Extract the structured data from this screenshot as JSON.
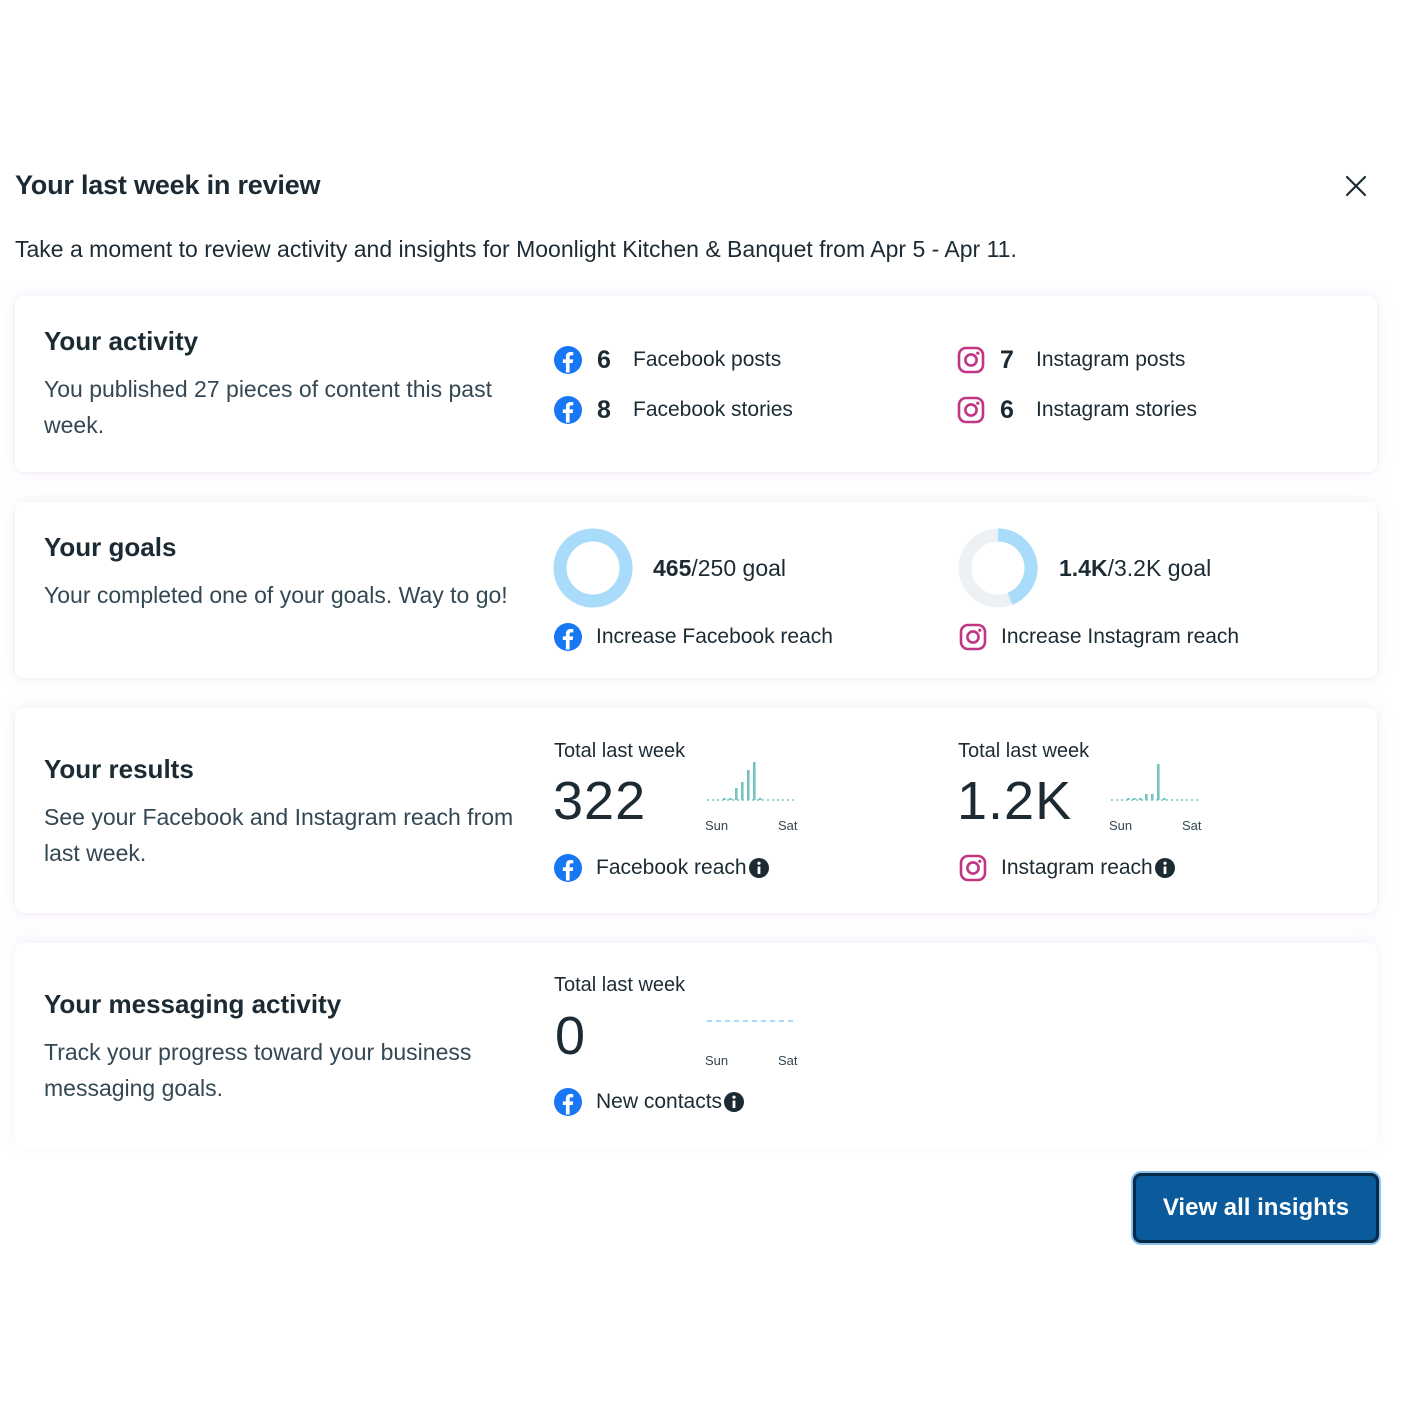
{
  "header": {
    "title": "Your last week in review",
    "subtitle": "Take a moment to review activity and insights for Moonlight Kitchen & Banquet from Apr 5 - Apr 11."
  },
  "activity": {
    "heading": "Your activity",
    "description": "You published 27 pieces of content this past week.",
    "stats": [
      {
        "count": "6",
        "label": "Facebook posts",
        "platform": "facebook-icon"
      },
      {
        "count": "8",
        "label": "Facebook stories",
        "platform": "facebook-icon"
      },
      {
        "count": "7",
        "label": "Instagram posts",
        "platform": "instagram-icon"
      },
      {
        "count": "6",
        "label": "Instagram stories",
        "platform": "instagram-icon"
      }
    ]
  },
  "goals": {
    "heading": "Your goals",
    "description": "Your completed one of your goals. Way to go!",
    "items": [
      {
        "value": "465",
        "target": "/250 goal",
        "label": "Increase Facebook reach",
        "progress": 1.0,
        "platform": "facebook-icon"
      },
      {
        "value": "1.4K",
        "target": "/3.2K goal",
        "label": "Increase Instagram reach",
        "progress": 0.44,
        "platform": "instagram-icon"
      }
    ]
  },
  "results": {
    "heading": "Your results",
    "description": "See your Facebook and Instagram reach from last week.",
    "metrics": [
      {
        "total_label": "Total last week",
        "total": "322",
        "label": "Facebook reach",
        "start_day": "Sun",
        "end_day": "Sat",
        "daily_share": [
          0.05,
          0.05,
          0.3,
          0.45,
          0.75,
          0.95,
          0.05
        ],
        "platform": "facebook-icon"
      },
      {
        "total_label": "Total last week",
        "total": "1.2K",
        "label": "Instagram reach",
        "start_day": "Sun",
        "end_day": "Sat",
        "daily_share": [
          0.05,
          0.05,
          0.05,
          0.15,
          0.15,
          0.9,
          0.05
        ],
        "platform": "instagram-icon"
      }
    ]
  },
  "messaging": {
    "heading": "Your messaging activity",
    "description": "Track your progress toward your business messaging goals.",
    "metric": {
      "total_label": "Total last week",
      "total": "0",
      "label": "New contacts",
      "start_day": "Sun",
      "end_day": "Sat",
      "platform": "facebook-icon"
    }
  },
  "footer": {
    "cta_label": "View all insights"
  },
  "colors": {
    "facebook": "#1877f2",
    "instagram": "#c13584",
    "ring_progress": "#a8dcfa",
    "ring_track": "#eef1f4",
    "spark_bar": "#74c3c2",
    "cta_background": "#0a5a9c"
  }
}
